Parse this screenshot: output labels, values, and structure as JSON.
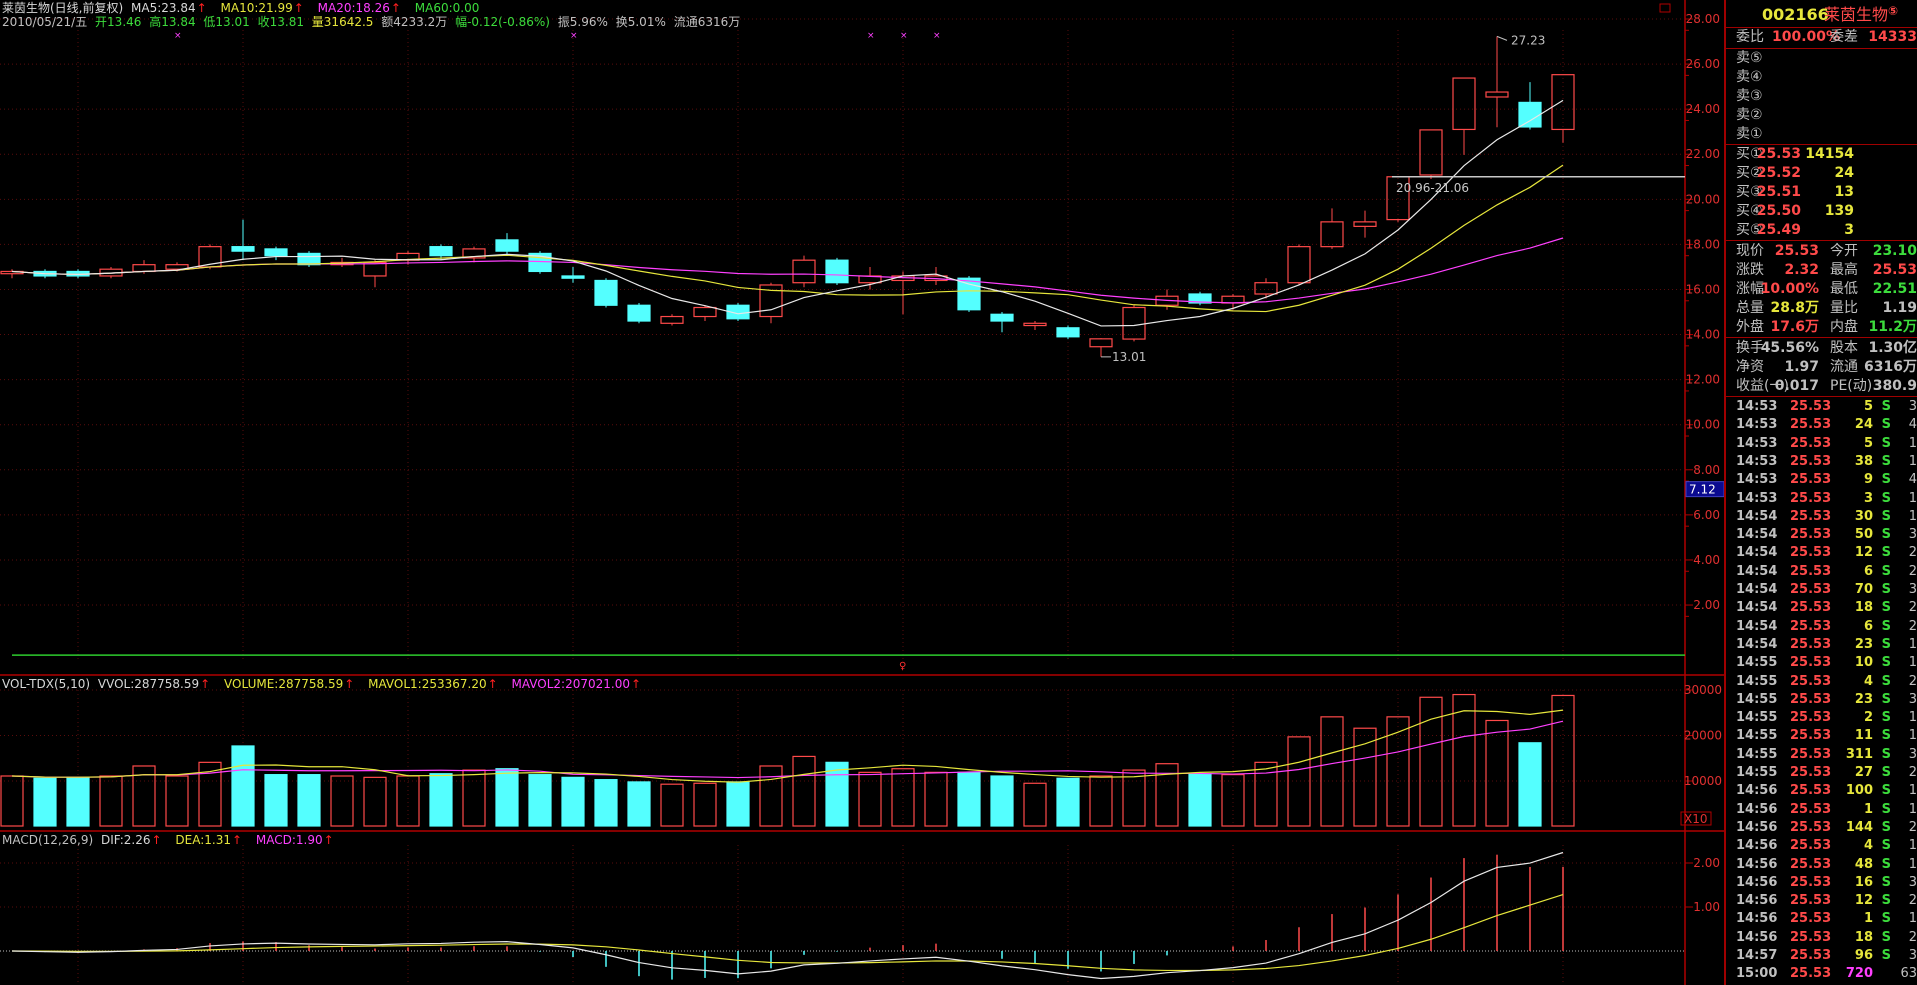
{
  "header": {
    "title": "莱茵生物(日线,前复权)",
    "ma5": "MA5:23.84",
    "ma10": "MA10:21.99",
    "ma20": "MA20:18.26",
    "ma60": "MA60:0.00",
    "date": "2010/05/21/五",
    "open": "开13.46",
    "high": "高13.84",
    "low": "低13.01",
    "close": "收13.81",
    "vol": "量31642.5",
    "amount": "额4233.2万",
    "change": "幅-0.12(-0.86%)",
    "amplitude": "振5.96%",
    "turnover": "换5.01%",
    "float": "流通6316万",
    "arrow": "↑"
  },
  "annotations": {
    "high_label": "27.23",
    "low_label": "13.01",
    "range_label": "20.96-21.06",
    "cursor_price": "7.12",
    "vol_scale": "X10"
  },
  "vol_header": {
    "name": "VOL-TDX(5,10)",
    "vvol": "VVOL:287758.59",
    "volume": "VOLUME:287758.59",
    "mavol1": "MAVOL1:253367.20",
    "mavol2": "MAVOL2:207021.00"
  },
  "macd_header": {
    "name": "MACD(12,26,9)",
    "dif": "DIF:2.26",
    "dea": "DEA:1.31",
    "macd": "MACD:1.90"
  },
  "axes": {
    "price_ticks": [
      "28.00",
      "26.00",
      "24.00",
      "22.00",
      "20.00",
      "18.00",
      "16.00",
      "14.00",
      "12.00",
      "10.00",
      "8.00",
      "6.00",
      "4.00",
      "2.00"
    ],
    "volume_ticks": [
      "30000",
      "20000",
      "10000"
    ],
    "macd_ticks": [
      "2.00",
      "1.00"
    ]
  },
  "colors": {
    "up": "#ff4a4a",
    "down": "#54ffff",
    "ma5": "#e8e8e8",
    "ma10": "#e6e63c",
    "ma20": "#ff40ff",
    "axis": "#b00000"
  },
  "chart_data": {
    "type": "candlestick",
    "ylim": [
      0,
      28
    ],
    "volume_ylim": [
      0,
      30000
    ],
    "macd_ylim": [
      -0.75,
      2.4
    ],
    "candles": [
      [
        16.7,
        16.9,
        16.5,
        16.8
      ],
      [
        16.8,
        16.9,
        16.5,
        16.6
      ],
      [
        16.8,
        16.9,
        16.5,
        16.6
      ],
      [
        16.6,
        17.0,
        16.5,
        16.9
      ],
      [
        16.8,
        17.3,
        16.7,
        17.1
      ],
      [
        16.9,
        17.2,
        16.8,
        17.1
      ],
      [
        17.0,
        18.0,
        16.9,
        17.9
      ],
      [
        17.9,
        19.1,
        17.3,
        17.7
      ],
      [
        17.8,
        17.9,
        17.3,
        17.5
      ],
      [
        17.6,
        17.7,
        17.0,
        17.1
      ],
      [
        17.1,
        17.4,
        17.0,
        17.2
      ],
      [
        16.6,
        17.3,
        16.1,
        17.2
      ],
      [
        17.3,
        17.7,
        17.1,
        17.6
      ],
      [
        17.9,
        18.0,
        17.3,
        17.5
      ],
      [
        17.4,
        17.9,
        17.2,
        17.8
      ],
      [
        18.2,
        18.5,
        17.5,
        17.7
      ],
      [
        17.6,
        17.7,
        16.7,
        16.8
      ],
      [
        16.6,
        17.0,
        16.3,
        16.5
      ],
      [
        16.4,
        16.5,
        15.2,
        15.3
      ],
      [
        15.3,
        15.4,
        14.5,
        14.6
      ],
      [
        14.5,
        14.9,
        14.4,
        14.8
      ],
      [
        14.8,
        15.3,
        14.6,
        15.2
      ],
      [
        15.3,
        15.4,
        14.6,
        14.7
      ],
      [
        14.8,
        16.3,
        14.5,
        16.2
      ],
      [
        16.3,
        17.5,
        16.1,
        17.3
      ],
      [
        17.3,
        17.4,
        16.2,
        16.3
      ],
      [
        16.3,
        17.0,
        16.0,
        16.6
      ],
      [
        16.4,
        16.8,
        14.9,
        16.6
      ],
      [
        16.4,
        17.0,
        16.2,
        16.6
      ],
      [
        16.5,
        16.6,
        15.0,
        15.1
      ],
      [
        14.9,
        15.0,
        14.1,
        14.6
      ],
      [
        14.4,
        14.6,
        14.2,
        14.5
      ],
      [
        14.3,
        14.4,
        13.8,
        13.9
      ],
      [
        13.46,
        13.84,
        13.01,
        13.81
      ],
      [
        13.8,
        15.3,
        13.7,
        15.2
      ],
      [
        15.3,
        16.0,
        15.1,
        15.7
      ],
      [
        15.8,
        15.9,
        15.3,
        15.4
      ],
      [
        15.4,
        15.8,
        15.1,
        15.7
      ],
      [
        15.8,
        16.5,
        15.6,
        16.3
      ],
      [
        16.3,
        18.0,
        16.2,
        17.9
      ],
      [
        17.9,
        19.6,
        17.8,
        19.0
      ],
      [
        18.8,
        19.5,
        18.3,
        19.0
      ],
      [
        19.1,
        21.0,
        19.0,
        21.0
      ],
      [
        21.08,
        23.1,
        20.9,
        23.08
      ],
      [
        23.1,
        25.4,
        21.97,
        25.38
      ],
      [
        24.54,
        27.23,
        23.2,
        24.76
      ],
      [
        24.3,
        25.2,
        23.1,
        23.21
      ],
      [
        23.1,
        25.53,
        22.51,
        25.53
      ]
    ],
    "candle_fields": [
      "open",
      "high",
      "low",
      "close"
    ],
    "volumes": [
      11100,
      10600,
      10800,
      11100,
      13300,
      11100,
      14100,
      17700,
      11400,
      11400,
      11100,
      10800,
      11100,
      11600,
      12400,
      12700,
      11400,
      10800,
      10300,
      9800,
      9300,
      9500,
      9800,
      13300,
      15400,
      14100,
      11900,
      12700,
      11900,
      11900,
      11100,
      9500,
      10600,
      11100,
      12400,
      13800,
      11600,
      11400,
      14100,
      19700,
      24100,
      21600,
      24100,
      28400,
      29000,
      23300,
      18400,
      28800
    ]
  },
  "quote": {
    "code": "002166",
    "name": "莱茵生物",
    "badge": "⑤",
    "wei_bi_label": "委比",
    "wei_bi": "100.00%",
    "wei_cha_label": "委差",
    "wei_cha": "14333",
    "asks": [
      {
        "label": "卖⑤",
        "price": "",
        "vol": ""
      },
      {
        "label": "卖④",
        "price": "",
        "vol": ""
      },
      {
        "label": "卖③",
        "price": "",
        "vol": ""
      },
      {
        "label": "卖②",
        "price": "",
        "vol": ""
      },
      {
        "label": "卖①",
        "price": "",
        "vol": ""
      }
    ],
    "bids": [
      {
        "label": "买①",
        "price": "25.53",
        "vol": "14154"
      },
      {
        "label": "买②",
        "price": "25.52",
        "vol": "24"
      },
      {
        "label": "买③",
        "price": "25.51",
        "vol": "13"
      },
      {
        "label": "买④",
        "price": "25.50",
        "vol": "139"
      },
      {
        "label": "买⑤",
        "price": "25.49",
        "vol": "3"
      }
    ],
    "stats": [
      {
        "l1": "现价",
        "v1": "25.53",
        "c1": "r",
        "l2": "今开",
        "v2": "23.10",
        "c2": "g"
      },
      {
        "l1": "涨跌",
        "v1": "2.32",
        "c1": "r",
        "l2": "最高",
        "v2": "25.53",
        "c2": "r"
      },
      {
        "l1": "涨幅",
        "v1": "10.00%",
        "c1": "r",
        "l2": "最低",
        "v2": "22.51",
        "c2": "g"
      },
      {
        "l1": "总量",
        "v1": "28.8万",
        "c1": "y",
        "l2": "量比",
        "v2": "1.19",
        "c2": "gy"
      },
      {
        "l1": "外盘",
        "v1": "17.6万",
        "c1": "r",
        "l2": "内盘",
        "v2": "11.2万",
        "c2": "g"
      }
    ],
    "fundamentals": [
      {
        "l1": "换手",
        "v1": "45.56%",
        "l2": "股本",
        "v2": "1.30亿"
      },
      {
        "l1": "净资",
        "v1": "1.97",
        "l2": "流通",
        "v2": "6316万"
      },
      {
        "l1": "收益(一)",
        "v1": "0.017",
        "l2": "PE(动)",
        "v2": "380.9"
      }
    ],
    "ticks": [
      [
        "14:53",
        "25.53",
        "5",
        "S",
        "3"
      ],
      [
        "14:53",
        "25.53",
        "24",
        "S",
        "4"
      ],
      [
        "14:53",
        "25.53",
        "5",
        "S",
        "1"
      ],
      [
        "14:53",
        "25.53",
        "38",
        "S",
        "1"
      ],
      [
        "14:53",
        "25.53",
        "9",
        "S",
        "4"
      ],
      [
        "14:53",
        "25.53",
        "3",
        "S",
        "1"
      ],
      [
        "14:54",
        "25.53",
        "30",
        "S",
        "1"
      ],
      [
        "14:54",
        "25.53",
        "50",
        "S",
        "3"
      ],
      [
        "14:54",
        "25.53",
        "12",
        "S",
        "2"
      ],
      [
        "14:54",
        "25.53",
        "6",
        "S",
        "2"
      ],
      [
        "14:54",
        "25.53",
        "70",
        "S",
        "3"
      ],
      [
        "14:54",
        "25.53",
        "18",
        "S",
        "2"
      ],
      [
        "14:54",
        "25.53",
        "6",
        "S",
        "2"
      ],
      [
        "14:54",
        "25.53",
        "23",
        "S",
        "1"
      ],
      [
        "14:55",
        "25.53",
        "10",
        "S",
        "1"
      ],
      [
        "14:55",
        "25.53",
        "4",
        "S",
        "2"
      ],
      [
        "14:55",
        "25.53",
        "23",
        "S",
        "3"
      ],
      [
        "14:55",
        "25.53",
        "2",
        "S",
        "1"
      ],
      [
        "14:55",
        "25.53",
        "11",
        "S",
        "1"
      ],
      [
        "14:55",
        "25.53",
        "311",
        "S",
        "3"
      ],
      [
        "14:55",
        "25.53",
        "27",
        "S",
        "2"
      ],
      [
        "14:56",
        "25.53",
        "100",
        "S",
        "1"
      ],
      [
        "14:56",
        "25.53",
        "1",
        "S",
        "1"
      ],
      [
        "14:56",
        "25.53",
        "144",
        "S",
        "2"
      ],
      [
        "14:56",
        "25.53",
        "4",
        "S",
        "1"
      ],
      [
        "14:56",
        "25.53",
        "48",
        "S",
        "1"
      ],
      [
        "14:56",
        "25.53",
        "16",
        "S",
        "3"
      ],
      [
        "14:56",
        "25.53",
        "12",
        "S",
        "2"
      ],
      [
        "14:56",
        "25.53",
        "1",
        "S",
        "1"
      ],
      [
        "14:56",
        "25.53",
        "18",
        "S",
        "2"
      ],
      [
        "14:57",
        "25.53",
        "96",
        "S",
        "3"
      ],
      [
        "15:00",
        "25.53",
        "720",
        "",
        "63"
      ]
    ]
  }
}
